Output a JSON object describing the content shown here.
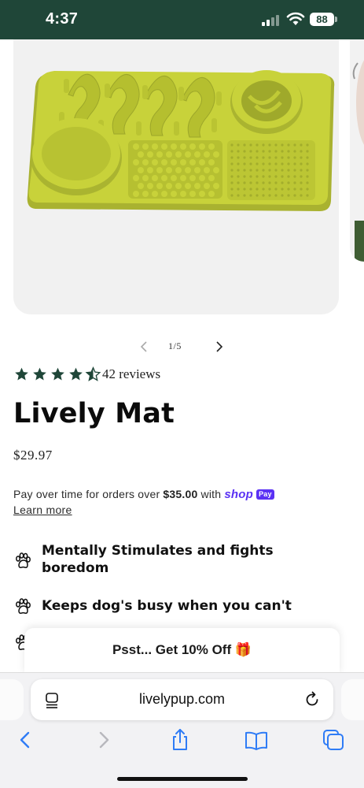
{
  "status_bar": {
    "time": "4:37",
    "battery": "88",
    "icons": [
      "signal-icon",
      "wifi-icon",
      "battery-icon"
    ]
  },
  "product": {
    "image_alt": "Lively Mat",
    "carousel": {
      "counter": "1/5",
      "prev_icon": "chevron-left-icon",
      "next_icon": "chevron-right-icon"
    },
    "rating": {
      "stars": 4.5,
      "max": 5,
      "reviews_label": "42 reviews"
    },
    "title": "Lively Mat",
    "price": "$29.97",
    "installments": {
      "text_before": "Pay over time for orders over ",
      "threshold": "$35.00",
      "text_after": " with ",
      "provider": "shop",
      "provider_badge": "Pay",
      "learn_more": "Learn more"
    },
    "benefits": [
      {
        "icon": "paw-icon",
        "text": "Mentally Stimulates and fights boredom"
      },
      {
        "icon": "paw-icon",
        "text": "Keeps dog's busy when you can't"
      },
      {
        "icon": "paw-icon",
        "text": ""
      }
    ]
  },
  "promo": {
    "text": "Psst... Get 10% Off 🎁"
  },
  "browser": {
    "url": "livelypup.com",
    "toolbar": [
      "back-icon",
      "forward-icon",
      "share-icon",
      "bookmarks-icon",
      "tabs-icon"
    ]
  },
  "colors": {
    "header_bg": "#1f4638",
    "star": "#1f4638",
    "shop_pay": "#5a31f4",
    "mat": "#c8d23a"
  }
}
